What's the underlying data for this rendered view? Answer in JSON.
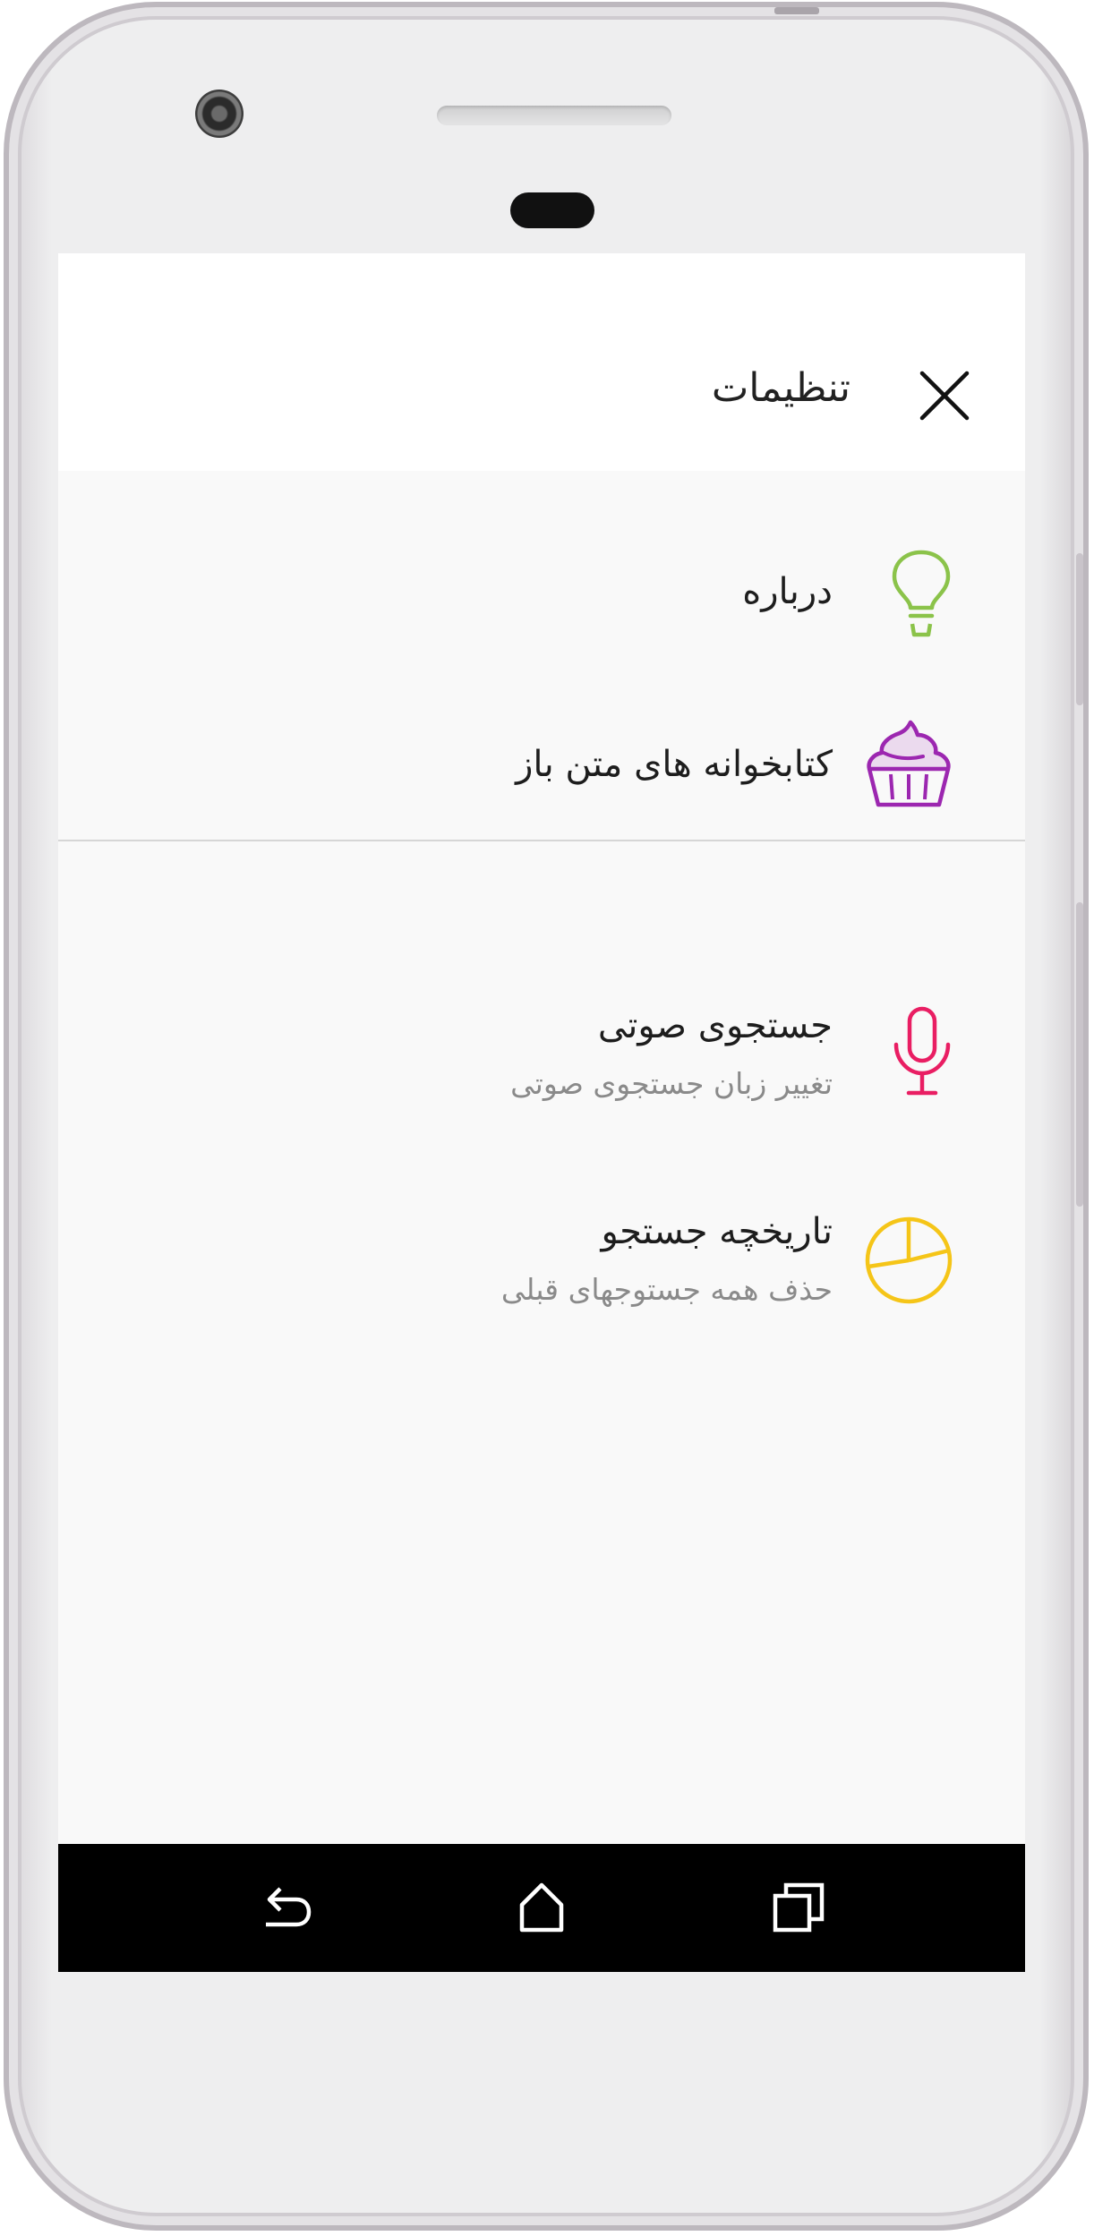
{
  "header": {
    "title": "تنظیمات"
  },
  "items": [
    {
      "title": "درباره",
      "icon": "lightbulb-icon",
      "color": "#8bc34a"
    },
    {
      "title": "کتابخوانه های متن باز",
      "icon": "cupcake-icon",
      "color": "#9c27b0"
    },
    {
      "title": "جستجوی صوتی",
      "subtitle": "تغییر زبان جستجوی صوتی",
      "icon": "microphone-icon",
      "color": "#e91e63"
    },
    {
      "title": "تاریخچه جستجو",
      "subtitle": "حذف همه جستوجهای قبلی",
      "icon": "pie-chart-icon",
      "color": "#f5c518"
    }
  ],
  "navbar": {
    "back_icon": "back-icon",
    "home_icon": "home-icon",
    "recents_icon": "recents-icon"
  }
}
